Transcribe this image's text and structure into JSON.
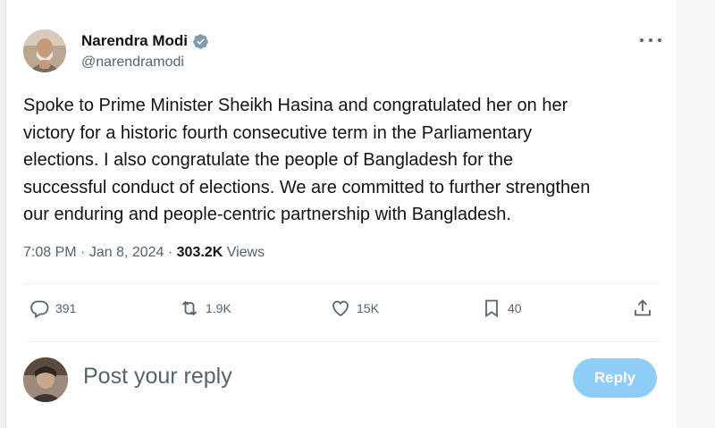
{
  "author": {
    "name": "Narendra Modi",
    "handle": "@narendramodi"
  },
  "tweet": {
    "text": "Spoke to Prime Minister Sheikh Hasina and congratulated her on her\nvictory for a historic fourth consecutive term in the Parliamentary\nelections. I also congratulate the people of Bangladesh for the\nsuccessful conduct of elections. We are committed to further strengthen\nour enduring and people-centric partnership with Bangladesh.",
    "time": "7:08 PM",
    "separator": " · ",
    "date": "Jan 8, 2024",
    "views_count": "303.2K",
    "views_label": " Views"
  },
  "actions": {
    "replies": "391",
    "reposts": "1.9K",
    "likes": "15K",
    "bookmarks": "40"
  },
  "reply": {
    "placeholder": "Post your reply",
    "button_label": "Reply"
  },
  "colors": {
    "text_primary": "#0f1419",
    "text_secondary": "#536471",
    "verified_blue": "#1d9bf0",
    "reply_button_disabled": "#8ecdf8",
    "divider": "#eff3f4"
  },
  "icons": {
    "verified": "verified-badge-icon",
    "more": "more-horizontal-icon",
    "reply": "comment-icon",
    "repost": "repost-icon",
    "like": "heart-icon",
    "bookmark": "bookmark-icon",
    "share": "share-icon"
  }
}
